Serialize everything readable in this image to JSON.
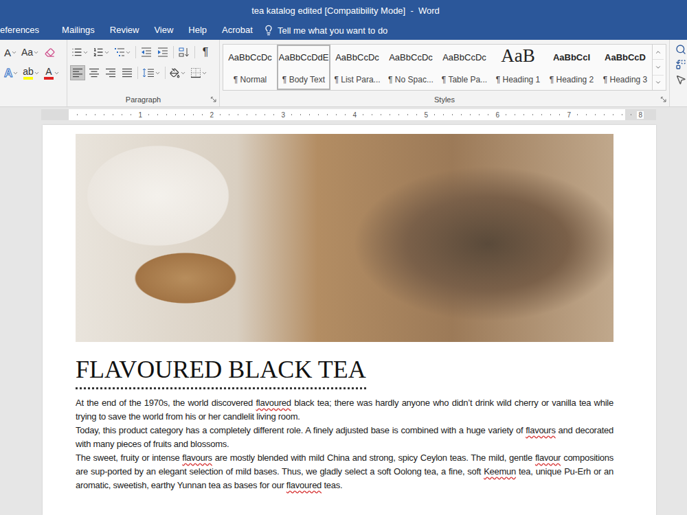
{
  "window": {
    "title": "tea katalog edited [Compatibility Mode]  -  Word"
  },
  "ribbon_tabs": [
    {
      "label": "eferences",
      "selected": false
    },
    {
      "label": "Mailings",
      "selected": false
    },
    {
      "label": "Review",
      "selected": false
    },
    {
      "label": "View",
      "selected": false
    },
    {
      "label": "Help",
      "selected": false
    },
    {
      "label": "Acrobat",
      "selected": false
    }
  ],
  "tell_me": {
    "placeholder": "Tell me what you want to do"
  },
  "font_group": {
    "grow": "A",
    "change_case": "Aa",
    "text_effects": "A",
    "highlight": "ab",
    "font_color": "A"
  },
  "paragraph_group": {
    "label": "Paragraph",
    "show_marks": "¶",
    "alignments": [
      {
        "kind": "left",
        "selected": true
      },
      {
        "kind": "center",
        "selected": false
      },
      {
        "kind": "right",
        "selected": false
      },
      {
        "kind": "justify",
        "selected": false
      }
    ]
  },
  "styles_group": {
    "label": "Styles",
    "styles": [
      {
        "preview": "AaBbCcDc",
        "name": "¶ Normal",
        "kind": "body",
        "selected": false
      },
      {
        "preview": "AaBbCcDdE",
        "name": "¶ Body Text",
        "kind": "body",
        "selected": true
      },
      {
        "preview": "AaBbCcDc",
        "name": "¶ List Para...",
        "kind": "body",
        "selected": false
      },
      {
        "preview": "AaBbCcDc",
        "name": "¶ No Spac...",
        "kind": "body",
        "selected": false
      },
      {
        "preview": "AaBbCcDc",
        "name": "¶ Table Pa...",
        "kind": "body",
        "selected": false
      },
      {
        "preview": "AaB",
        "name": "¶ Heading 1",
        "kind": "title",
        "selected": false
      },
      {
        "preview": "AaBbCcI",
        "name": "¶ Heading 2",
        "kind": "heading",
        "selected": false
      },
      {
        "preview": "AaBbCcD",
        "name": "¶ Heading 3",
        "kind": "heading",
        "selected": false
      }
    ]
  },
  "ruler": {
    "ticks": [
      "1",
      "2",
      "3",
      "4",
      "5",
      "6",
      "7",
      "8"
    ]
  },
  "document": {
    "heading": "FLAVOURED BLACK TEA",
    "paragraphs": [
      [
        {
          "text": "At the end of the 1970s, the world discovered ",
          "misspelled": false
        },
        {
          "text": "flavoured",
          "misspelled": true
        },
        {
          "text": " black tea; there was hardly anyone who didn’t drink wild cherry or vanilla tea while trying to save the world from his or her candlelit living room.",
          "misspelled": false
        }
      ],
      [
        {
          "text": "Today, this product category has a completely different role. A finely adjusted base is combined with a huge variety of ",
          "misspelled": false
        },
        {
          "text": "flavours",
          "misspelled": true
        },
        {
          "text": " and decorated with many pieces of fruits and blossoms.",
          "misspelled": false
        }
      ],
      [
        {
          "text": "The sweet, fruity or intense ",
          "misspelled": false
        },
        {
          "text": "flavours",
          "misspelled": true
        },
        {
          "text": " are mostly blended with mild China and strong, spicy Ceylon teas. The mild, gentle ",
          "misspelled": false
        },
        {
          "text": "flavour",
          "misspelled": true
        },
        {
          "text": " compositions are sup-ported by an elegant selection of mild bases. Thus, we gladly select a soft Oolong tea, a fine, soft ",
          "misspelled": false
        },
        {
          "text": "Keemun",
          "misspelled": true
        },
        {
          "text": " tea, unique Pu-Erh or an aromatic, sweetish, earthy Yunnan tea as bases for our ",
          "misspelled": false
        },
        {
          "text": "flavoured",
          "misspelled": true
        },
        {
          "text": " teas.",
          "misspelled": false
        }
      ]
    ]
  }
}
